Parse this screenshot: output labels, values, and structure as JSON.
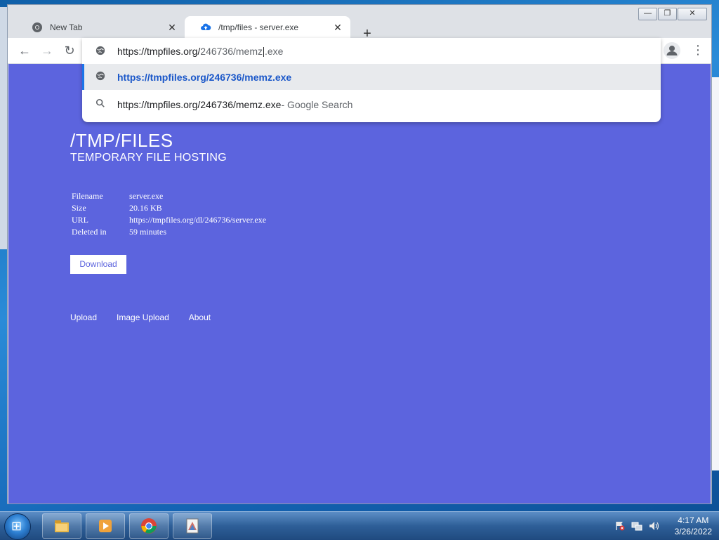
{
  "browser": {
    "tabs": [
      {
        "title": "New Tab",
        "icon": "chrome-icon",
        "active": false
      },
      {
        "title": "/tmp/files - server.exe",
        "icon": "cloud-upload-icon",
        "active": true
      }
    ],
    "new_tab_label": "+",
    "window_controls": {
      "minimize": "—",
      "restore": "❐",
      "close": "✕"
    },
    "toolbar": {
      "back": "←",
      "forward": "→",
      "reload": "↻",
      "menu": "⋮"
    }
  },
  "omnibox": {
    "typed_prefix": "https://tmpfiles.org/",
    "typed_suffix": "246736/memz",
    "typed_end": ".exe",
    "suggestions": [
      {
        "text": "https://tmpfiles.org/246736/memz.exe",
        "icon": "globe-icon"
      },
      {
        "text": "https://tmpfiles.org/246736/memz.exe",
        "suffix": " - Google Search",
        "icon": "search-icon"
      }
    ]
  },
  "page": {
    "title": "/TMP/FILES",
    "subtitle": "TEMPORARY FILE HOSTING",
    "info": [
      {
        "key": "Filename",
        "value": "server.exe"
      },
      {
        "key": "Size",
        "value": "20.16 KB"
      },
      {
        "key": "URL",
        "value": "https://tmpfiles.org/dl/246736/server.exe"
      },
      {
        "key": "Deleted in",
        "value": "59 minutes"
      }
    ],
    "download_label": "Download",
    "footer_links": [
      "Upload",
      "Image Upload",
      "About"
    ],
    "background_color": "#5c64de"
  },
  "taskbar": {
    "start_label": "⊞",
    "apps": [
      "file-explorer-icon",
      "media-player-icon",
      "chrome-icon",
      "paint-icon"
    ],
    "clock_time": "4:17 AM",
    "clock_date": "3/26/2022"
  }
}
